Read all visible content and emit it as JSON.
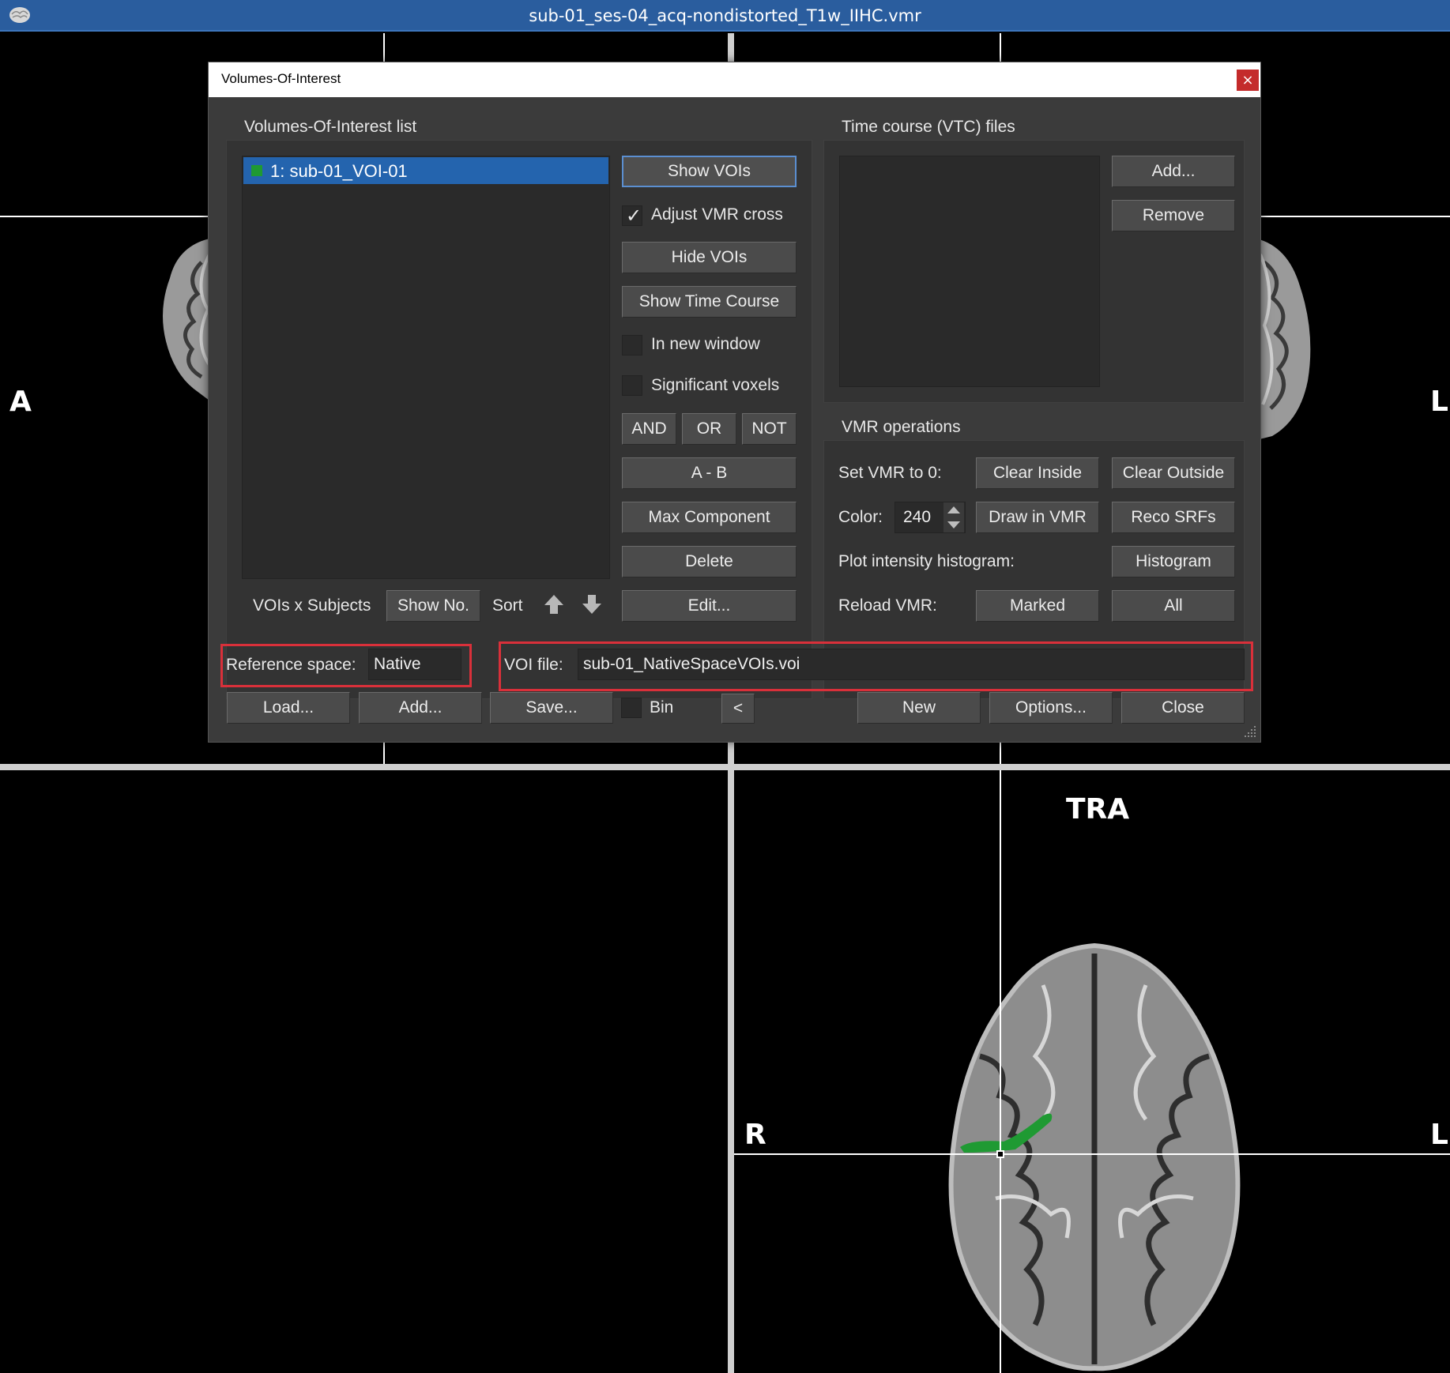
{
  "window": {
    "title": "sub-01_ses-04_acq-nondistorted_T1w_IIHC.vmr"
  },
  "viewer": {
    "orientation_labels": {
      "top_left": "A",
      "top_right": "L",
      "bottom_left": "R",
      "bottom_right": "L"
    },
    "view_name": "TRA",
    "voi_color": "#1f9a33"
  },
  "dialog": {
    "title": "Volumes-Of-Interest",
    "close_glyph": "×",
    "voi_list": {
      "label": "Volumes-Of-Interest list",
      "items": [
        {
          "label": "1: sub-01_VOI-01",
          "color": "#1f9a33",
          "selected": true
        }
      ]
    },
    "voi_actions": {
      "show_vois": "Show VOIs",
      "adjust_vmr_cross": {
        "label": "Adjust VMR cross",
        "checked": true
      },
      "hide_vois": "Hide VOIs",
      "show_time_course": "Show Time Course",
      "in_new_window": {
        "label": "In new window",
        "checked": false
      },
      "significant_voxels": {
        "label": "Significant voxels",
        "checked": false
      },
      "and": "AND",
      "or": "OR",
      "not": "NOT",
      "a_minus_b": "A - B",
      "max_component": "Max Component",
      "delete": "Delete",
      "edit": "Edit..."
    },
    "list_footer": {
      "vois_x_subjects": "VOIs x Subjects",
      "show_no": "Show No.",
      "sort": "Sort"
    },
    "vtc": {
      "label": "Time course (VTC) files",
      "add": "Add...",
      "remove": "Remove"
    },
    "vmr_ops": {
      "label": "VMR operations",
      "set_vmr_to_0": "Set VMR to 0:",
      "clear_inside": "Clear Inside",
      "clear_outside": "Clear Outside",
      "color_label": "Color:",
      "color_value": "240",
      "draw_in_vmr": "Draw in VMR",
      "reco_srfs": "Reco SRFs",
      "plot_histogram_label": "Plot intensity histogram:",
      "histogram": "Histogram",
      "reload_vmr": "Reload VMR:",
      "marked": "Marked",
      "all": "All"
    },
    "reference_space": {
      "label": "Reference space:",
      "value": "Native"
    },
    "voi_file": {
      "label": "VOI file:",
      "value": "sub-01_NativeSpaceVOIs.voi"
    },
    "bottom": {
      "load": "Load...",
      "add": "Add...",
      "save": "Save...",
      "bin": {
        "label": "Bin",
        "checked": false
      },
      "collapse": "<",
      "new": "New",
      "options": "Options...",
      "close": "Close"
    }
  }
}
